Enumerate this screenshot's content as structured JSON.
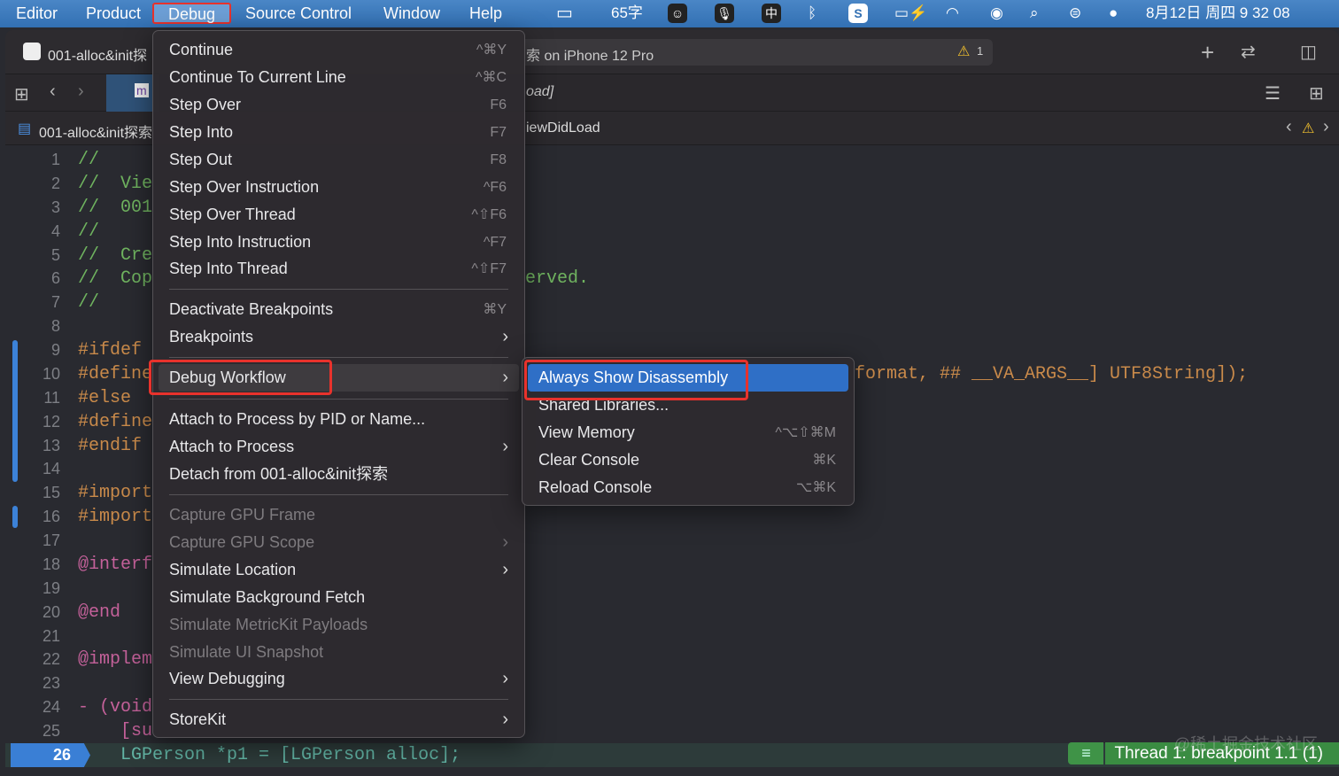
{
  "menubar": {
    "items": [
      "Editor",
      "Product",
      "Debug",
      "Source Control",
      "Window",
      "Help"
    ],
    "status": {
      "word_count": "65字",
      "input_method": "中",
      "datetime": "8月12日 周四  9 32 08"
    }
  },
  "toolbar": {
    "project": "001-alloc&init探",
    "scheme": "索 on iPhone 12 Pro",
    "warning_count": "1"
  },
  "tabbar": {
    "tab_fragment": "oad]"
  },
  "jumpbar": {
    "file": "001-alloc&init探索",
    "symbol": "iewDidLoad"
  },
  "editor": {
    "lines": [
      {
        "n": "1",
        "t": "//",
        "c": "c-comment"
      },
      {
        "n": "2",
        "t": "//  Vie",
        "c": "c-comment"
      },
      {
        "n": "3",
        "t": "//  001",
        "c": "c-comment"
      },
      {
        "n": "4",
        "t": "//",
        "c": "c-comment"
      },
      {
        "n": "5",
        "t": "//  Cre",
        "c": "c-comment"
      },
      {
        "n": "6",
        "t": "//  Cop",
        "c": "c-comment"
      },
      {
        "n": "7",
        "t": "//",
        "c": "c-comment"
      },
      {
        "n": "8",
        "t": "",
        "c": "c-plain"
      },
      {
        "n": "9",
        "t": "#ifdef",
        "c": "c-pre"
      },
      {
        "n": "10",
        "t": "#define",
        "c": "c-pre"
      },
      {
        "n": "11",
        "t": "#else",
        "c": "c-pre"
      },
      {
        "n": "12",
        "t": "#define",
        "c": "c-pre"
      },
      {
        "n": "13",
        "t": "#endif",
        "c": "c-pre"
      },
      {
        "n": "14",
        "t": "",
        "c": "c-plain"
      },
      {
        "n": "15",
        "t": "#import",
        "c": "c-pre"
      },
      {
        "n": "16",
        "t": "#import",
        "c": "c-pre"
      },
      {
        "n": "17",
        "t": "",
        "c": "c-plain"
      },
      {
        "n": "18",
        "t": "@interf",
        "c": "c-kw"
      },
      {
        "n": "19",
        "t": "",
        "c": "c-plain"
      },
      {
        "n": "20",
        "t": "@end",
        "c": "c-kw"
      },
      {
        "n": "21",
        "t": "",
        "c": "c-plain"
      },
      {
        "n": "22",
        "t": "@implem",
        "c": "c-kw"
      },
      {
        "n": "23",
        "t": "",
        "c": "c-plain"
      },
      {
        "n": "24",
        "t": "- (void",
        "c": "c-kw"
      },
      {
        "n": "25",
        "t": "    [su",
        "c": "c-kw"
      },
      {
        "n": "26",
        "t": "    LGPerson *p1 = [LGPerson alloc];",
        "c": "c-type"
      }
    ],
    "line6_tail": "erved.",
    "line10_tail": "format, ## __VA_ARGS__] UTF8String]);"
  },
  "status": {
    "thread": "Thread 1: breakpoint 1.1 (1)"
  },
  "debug_menu": {
    "items": [
      {
        "label": "Continue",
        "shortcut": "^⌘Y"
      },
      {
        "label": "Continue To Current Line",
        "shortcut": "^⌘C"
      },
      {
        "label": "Step Over",
        "shortcut": "F6"
      },
      {
        "label": "Step Into",
        "shortcut": "F7"
      },
      {
        "label": "Step Out",
        "shortcut": "F8"
      },
      {
        "label": "Step Over Instruction",
        "shortcut": "^F6"
      },
      {
        "label": "Step Over Thread",
        "shortcut": "^⇧F6"
      },
      {
        "label": "Step Into Instruction",
        "shortcut": "^F7"
      },
      {
        "label": "Step Into Thread",
        "shortcut": "^⇧F7"
      },
      {
        "label": "Deactivate Breakpoints",
        "shortcut": "⌘Y"
      },
      {
        "label": "Breakpoints"
      },
      {
        "label": "Debug Workflow"
      },
      {
        "label": "Attach to Process by PID or Name..."
      },
      {
        "label": "Attach to Process"
      },
      {
        "label": "Detach from 001-alloc&init探索"
      },
      {
        "label": "Capture GPU Frame"
      },
      {
        "label": "Capture GPU Scope"
      },
      {
        "label": "Simulate Location"
      },
      {
        "label": "Simulate Background Fetch"
      },
      {
        "label": "Simulate MetricKit Payloads"
      },
      {
        "label": "Simulate UI Snapshot"
      },
      {
        "label": "View Debugging"
      },
      {
        "label": "StoreKit"
      }
    ]
  },
  "submenu": {
    "items": [
      {
        "label": "Always Show Disassembly"
      },
      {
        "label": "Shared Libraries..."
      },
      {
        "label": "View Memory",
        "shortcut": "^⌥⇧⌘M"
      },
      {
        "label": "Clear Console",
        "shortcut": "⌘K"
      },
      {
        "label": "Reload Console",
        "shortcut": "⌥⌘K"
      }
    ]
  },
  "watermark": "@稀土掘金技术社区",
  "colors": {
    "accent": "#2f6fc6",
    "highlight_box": "#e8322c",
    "status_green": "#3a8c42"
  }
}
